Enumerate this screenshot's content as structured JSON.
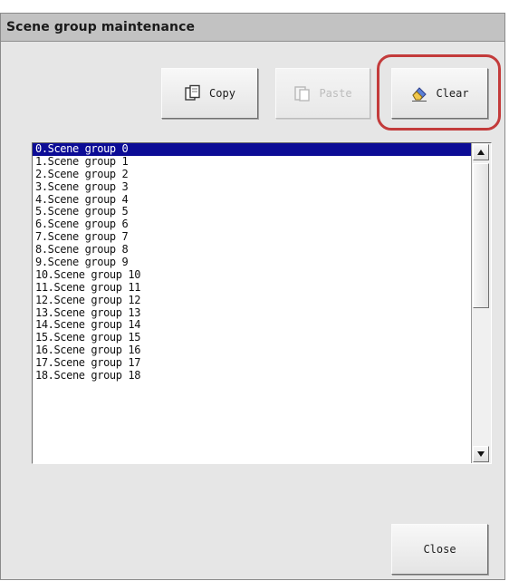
{
  "window": {
    "title": "Scene group maintenance"
  },
  "toolbar": {
    "copy_label": "Copy",
    "paste_label": "Paste",
    "clear_label": "Clear",
    "copy_icon": "copy-icon",
    "paste_icon": "paste-icon",
    "clear_icon": "eraser-icon"
  },
  "scene_groups": {
    "selected_index": 0,
    "items": [
      "0.Scene group 0",
      "1.Scene group 1",
      "2.Scene group 2",
      "3.Scene group 3",
      "4.Scene group 4",
      "5.Scene group 5",
      "6.Scene group 6",
      "7.Scene group 7",
      "8.Scene group 8",
      "9.Scene group 9",
      "10.Scene group 10",
      "11.Scene group 11",
      "12.Scene group 12",
      "13.Scene group 13",
      "14.Scene group 14",
      "15.Scene group 15",
      "16.Scene group 16",
      "17.Scene group 17",
      "18.Scene group 18"
    ]
  },
  "footer": {
    "close_label": "Close"
  },
  "colors": {
    "selection": "#0c0c96",
    "highlight_ring": "#c33b3b",
    "dialog_bg": "#e6e6e6",
    "titlebar_bg": "#c2c2c2"
  }
}
